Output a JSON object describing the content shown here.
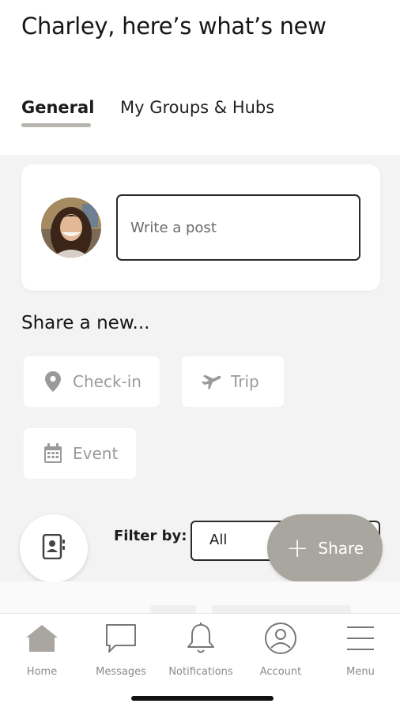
{
  "header": {
    "title": "Charley, here’s what’s new"
  },
  "tabs": [
    {
      "label": "General",
      "active": true
    },
    {
      "label": "My Groups & Hubs",
      "active": false
    }
  ],
  "composer": {
    "placeholder": "Write a post"
  },
  "share_section": {
    "heading": "Share a new...",
    "buttons": [
      {
        "label": "Check-in",
        "icon": "map-pin-icon"
      },
      {
        "label": "Trip",
        "icon": "airplane-icon"
      },
      {
        "label": "Event",
        "icon": "calendar-icon"
      }
    ]
  },
  "filter": {
    "label": "Filter by:",
    "selected": "All"
  },
  "share_fab": {
    "label": "Share",
    "icon": "plus-icon"
  },
  "bottom_nav": [
    {
      "label": "Home",
      "icon": "home-icon",
      "active": true
    },
    {
      "label": "Messages",
      "icon": "chat-bubble-icon"
    },
    {
      "label": "Notifications",
      "icon": "bell-icon"
    },
    {
      "label": "Account",
      "icon": "user-circle-icon"
    },
    {
      "label": "Menu",
      "icon": "hamburger-icon"
    }
  ],
  "colors": {
    "accent": "#a9a69f",
    "feed_background": "#f2f3f2",
    "muted_text": "#9a9a9a"
  }
}
